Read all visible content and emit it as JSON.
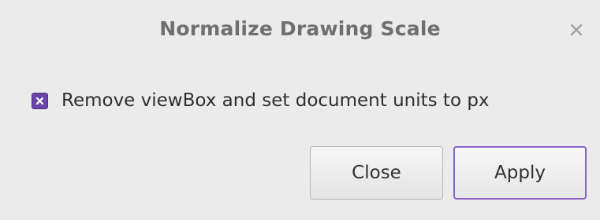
{
  "dialog": {
    "title": "Normalize Drawing Scale",
    "close_icon": "close-icon",
    "accent_color": "#6a44a8"
  },
  "options": {
    "remove_viewbox": {
      "label": "Remove viewBox and set document units to px",
      "checked": true
    }
  },
  "buttons": {
    "close_label": "Close",
    "apply_label": "Apply"
  }
}
